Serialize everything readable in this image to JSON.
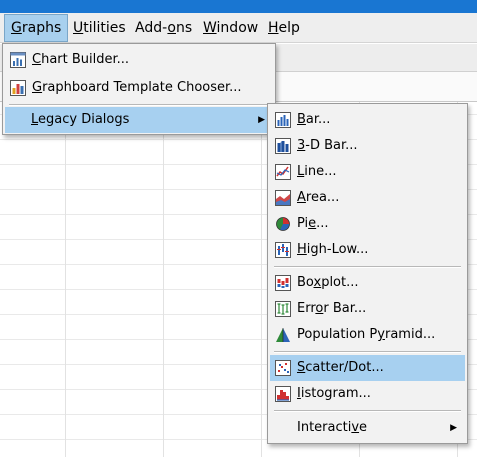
{
  "menubar": {
    "items": [
      {
        "pre": "",
        "key": "G",
        "post": "raphs"
      },
      {
        "pre": "",
        "key": "U",
        "post": "tilities"
      },
      {
        "pre": "Add-",
        "key": "o",
        "post": "ns"
      },
      {
        "pre": "",
        "key": "W",
        "post": "indow"
      },
      {
        "pre": "",
        "key": "H",
        "post": "elp"
      }
    ]
  },
  "graphs_menu": {
    "items": [
      {
        "pre": "",
        "key": "C",
        "post": "hart Builder...",
        "icon": "chart-builder-icon"
      },
      {
        "pre": "",
        "key": "G",
        "post": "raphboard Template Chooser...",
        "icon": "graphboard-icon"
      },
      {
        "pre": "",
        "key": "L",
        "post": "egacy Dialogs",
        "submenu_arrow": "▶"
      }
    ]
  },
  "legacy_menu": {
    "items": [
      {
        "pre": "",
        "key": "B",
        "post": "ar...",
        "icon": "bar-chart-icon"
      },
      {
        "pre": "",
        "key": "3",
        "post": "-D Bar...",
        "icon": "3d-bar-chart-icon"
      },
      {
        "pre": "",
        "key": "L",
        "post": "ine...",
        "icon": "line-chart-icon"
      },
      {
        "pre": "",
        "key": "A",
        "post": "rea...",
        "icon": "area-chart-icon"
      },
      {
        "pre": "Pi",
        "key": "e",
        "post": "...",
        "icon": "pie-chart-icon"
      },
      {
        "pre": "",
        "key": "H",
        "post": "igh-Low...",
        "icon": "high-low-chart-icon"
      },
      {
        "pre": "Bo",
        "key": "x",
        "post": "plot...",
        "icon": "boxplot-icon"
      },
      {
        "pre": "Err",
        "key": "o",
        "post": "r Bar...",
        "icon": "error-bar-icon"
      },
      {
        "pre": "Population P",
        "key": "y",
        "post": "ramid...",
        "icon": "population-pyramid-icon"
      },
      {
        "pre": "",
        "key": "S",
        "post": "catter/Dot...",
        "icon": "scatter-dot-icon"
      },
      {
        "pre": "",
        "key": "I",
        "post": "istogram...",
        "icon": "histogram-icon"
      },
      {
        "pre": "Interacti",
        "key": "v",
        "post": "e",
        "submenu_arrow": "▶"
      }
    ]
  },
  "colors": {
    "titlebar": "#1976d2",
    "selection": "#a7d0f0",
    "menu_bg": "#f2f2f2"
  }
}
